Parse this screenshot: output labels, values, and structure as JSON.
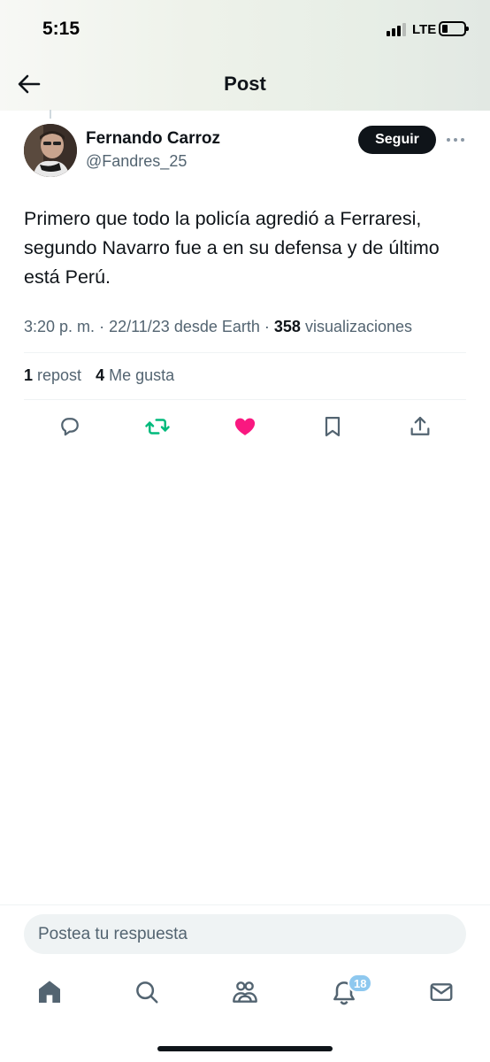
{
  "status_bar": {
    "time": "5:15",
    "network": "LTE"
  },
  "header": {
    "title": "Post",
    "back_icon": "arrow-left-icon"
  },
  "post": {
    "author_name": "Fernando Carroz",
    "author_handle": "@Fandres_25",
    "follow_label": "Seguir",
    "text": "Primero que todo la policía agredió a Ferraresi, segundo Navarro fue a en su defensa y de último está Perú.",
    "time": "3:20 p. m.",
    "date": "22/11/23",
    "source": "desde Earth",
    "views_count": "358",
    "views_label": "visualizaciones",
    "reposts_count": "1",
    "reposts_label": "repost",
    "likes_count": "4",
    "likes_label": "Me gusta",
    "liked": true
  },
  "actions": {
    "reply_icon": "reply-icon",
    "repost_icon": "repost-icon",
    "like_icon": "heart-icon",
    "bookmark_icon": "bookmark-icon",
    "share_icon": "share-icon"
  },
  "reply": {
    "placeholder": "Postea tu respuesta"
  },
  "tabbar": {
    "items": [
      "home-icon",
      "search-icon",
      "communities-icon",
      "notifications-icon",
      "messages-icon"
    ],
    "notifications_badge": "18"
  },
  "colors": {
    "like": "#f91880",
    "repost": "#00ba7c",
    "badge": "#8ec8ef",
    "text_secondary": "#536471"
  }
}
